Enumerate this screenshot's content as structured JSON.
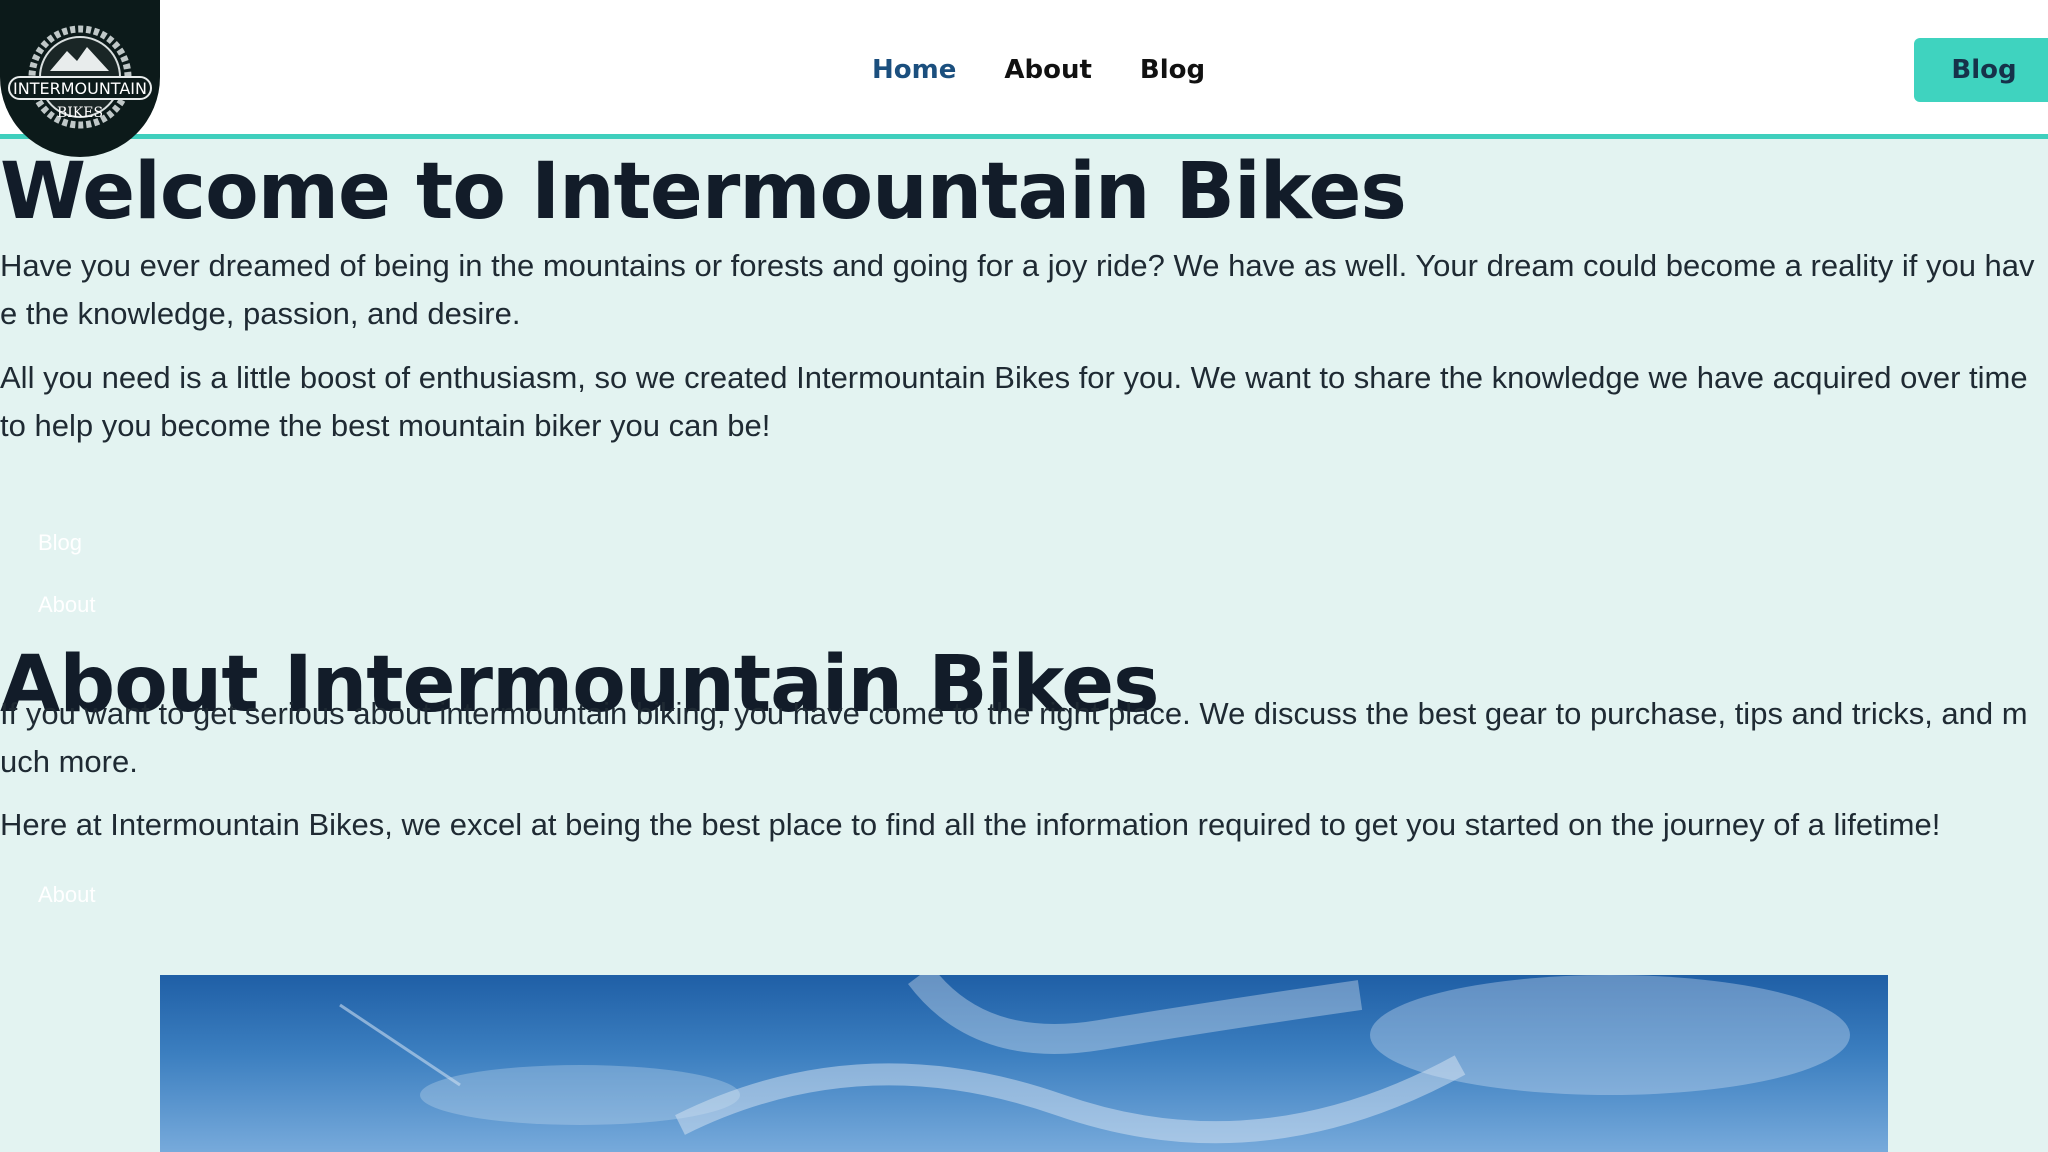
{
  "header": {
    "logo": {
      "line1": "INTERMOUNTAIN",
      "line2": "BIKES",
      "icon": "bike-gear-logo"
    },
    "nav": [
      {
        "label": "Home",
        "active": true
      },
      {
        "label": "About",
        "active": false
      },
      {
        "label": "Blog",
        "active": false
      }
    ],
    "cta_label": "Blog"
  },
  "welcome": {
    "title": "Welcome to Intermountain Bikes",
    "p1": "Have you ever dreamed of being in the mountains or forests and going for a joy ride? We have as well. Your dream could become a reality if you have the knowledge, passion, and desire.",
    "p2": "All you need is a little boost of enthusiasm, so we created Intermountain Bikes for you. We want to share the knowledge we have acquired over time to help you become the best mountain biker you can be!",
    "links": [
      "Blog",
      "About"
    ]
  },
  "about": {
    "title": "About Intermountain Bikes",
    "p1": "If you want to get serious about intermountain biking, you have come to the right place. We discuss the best gear to purchase, tips and tricks, and much more.",
    "p2": "Here at Intermountain Bikes, we excel at being the best place to find all the information required to get you started on the journey of a lifetime!",
    "link": "About"
  },
  "hero_image": {
    "alt": "sky-photo",
    "colors": [
      "#1f5fa6",
      "#77aadb"
    ]
  }
}
